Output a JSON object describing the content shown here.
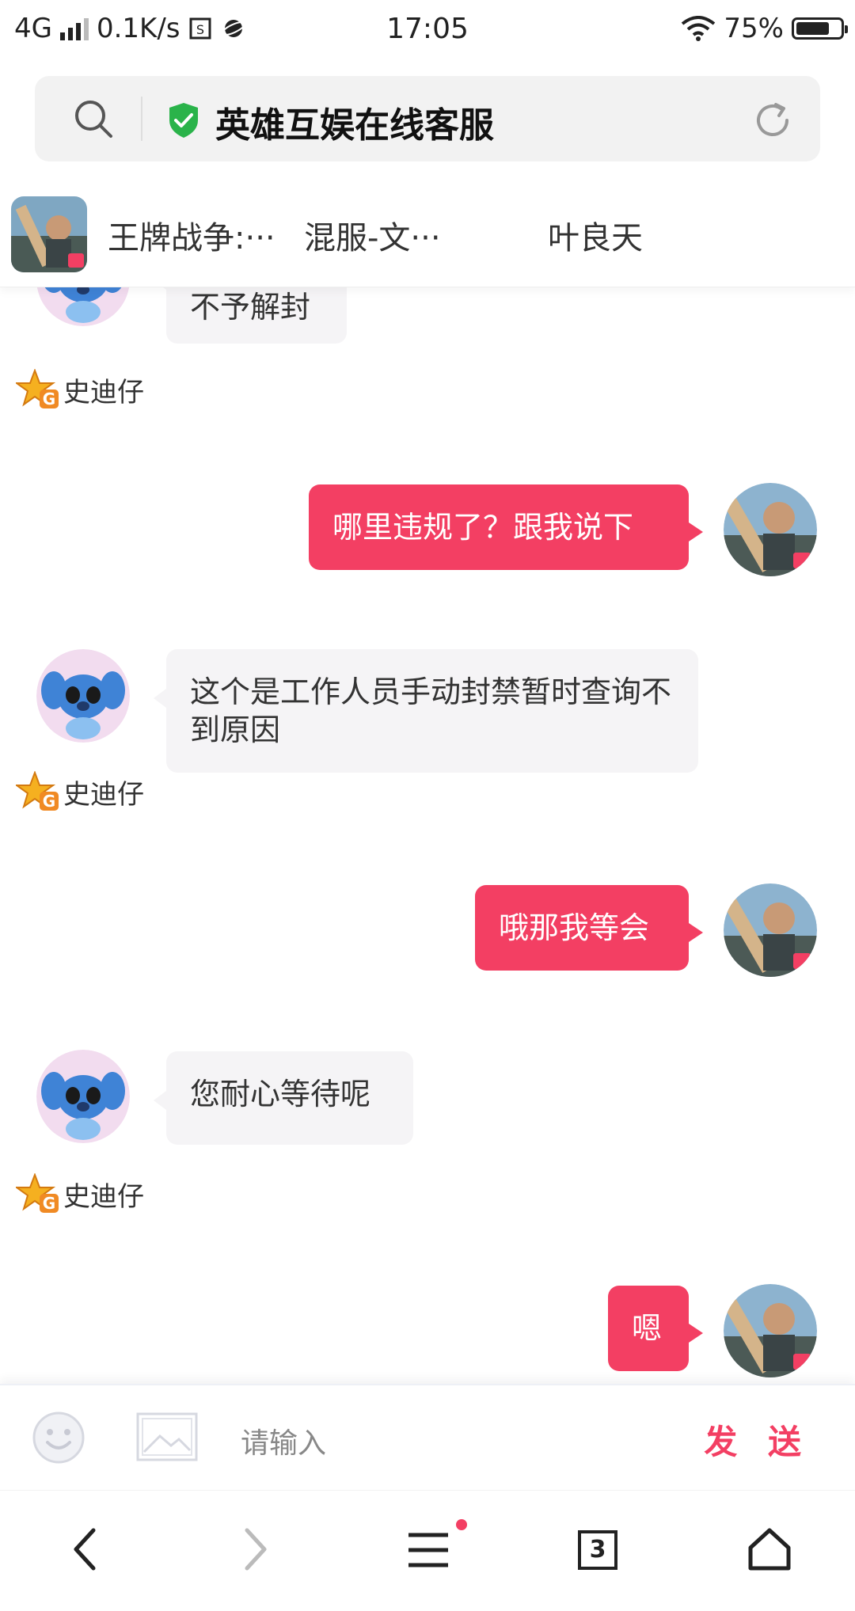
{
  "status_bar": {
    "network": "4G",
    "speed": "0.1K/s",
    "time": "17:05",
    "battery": "75%",
    "battery_level": 0.75
  },
  "address_bar": {
    "title": "英雄互娱在线客服"
  },
  "header": {
    "game_title": "王牌战争:···",
    "server": "混服-文···",
    "player": "叶良天"
  },
  "chat": {
    "agent_name": "史迪仔",
    "messages": [
      {
        "from": "agent",
        "text": "不予解封"
      },
      {
        "from": "user",
        "text": "哪里违规了？跟我说下"
      },
      {
        "from": "agent",
        "text": "这个是工作人员手动封禁暂时查询不到原因"
      },
      {
        "from": "user",
        "text": "哦那我等会"
      },
      {
        "from": "agent",
        "text": "您耐心等待呢"
      },
      {
        "from": "user",
        "text": "嗯"
      }
    ]
  },
  "input": {
    "placeholder": "请输入",
    "send_label": "发 送"
  },
  "bottom_nav": {
    "tabs_count": "3"
  },
  "colors": {
    "accent": "#f33f63",
    "incoming_bubble": "#f5f4f6",
    "shield": "#2ab34a"
  }
}
